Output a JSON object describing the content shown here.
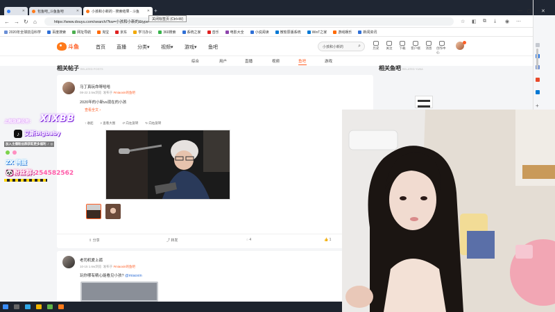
{
  "browser": {
    "tabs": [
      {
        "title": "",
        "active": false
      },
      {
        "title": "包鱼吧_斗鱼鱼吧",
        "active": false
      },
      {
        "title": "小孩和小新的 - 搜索结果 - 斗鱼",
        "active": true
      }
    ],
    "tooltip": "关闭标签页 (Ctrl+W)",
    "url": "https://www.douyu.com/search/?kw=小孩和小新的&type=",
    "bookmarks": [
      "2020年全球前沿科学",
      "百度搜索",
      "网址导航",
      "淘宝",
      "京东",
      "学习办公",
      "360搜索",
      "系统之家",
      "音乐",
      "电影大全",
      "小说阅读",
      "微软原版系统",
      "WinT之家",
      "游戏娱乐",
      "新闻资讯"
    ]
  },
  "site": {
    "brand": "斗鱼",
    "nav": [
      "首页",
      "直播",
      "分类▾",
      "视频▾",
      "游戏▾",
      "鱼吧"
    ],
    "search_placeholder": "小孩和小新的",
    "user_icons": [
      "历史",
      "关注",
      "下载",
      "客户端",
      "消息",
      "创作中心"
    ],
    "subtabs": [
      "综合",
      "用户",
      "直播",
      "视频",
      "鱼吧",
      "游戏"
    ],
    "active_subtab": "鱼吧",
    "section_left": "相关帖子",
    "section_left_sub": "RELATED POSTS",
    "section_right": "相关鱼吧",
    "section_right_sub": "RELATED YUBA"
  },
  "post1": {
    "author": "马丁真玩命呀哈哈",
    "meta_date": "08-22 2.5w浏览",
    "meta_from": "发布于",
    "meta_channel": "#miaoxin的鱼吧",
    "text": "2020年的小新vs现在的小孩",
    "more": "查看全文 ›",
    "tools": [
      "↑ 收起",
      "查看大图",
      "向左旋转",
      "向右旋转"
    ],
    "actions": {
      "share": "分享",
      "forward": "转发",
      "comments": "4",
      "likes": "1"
    }
  },
  "post2": {
    "author": "老司机爱上孤",
    "meta_date": "10-15 1.6w浏览",
    "meta_from": "发布于",
    "meta_channel": "#miaoxin的鱼吧",
    "text": "玩你哪有精心能看见小孩?",
    "mention": "@miaoxin"
  },
  "overlay": {
    "line1_label": "上舰急建设者：",
    "line1_name": "XIXBB",
    "tiktok_name": "艾斯bigbaby",
    "line3": "加入主播粉丝群获取更多福利 ♪ ◎",
    "line4": "ZX 鸭蛋",
    "line5_label": "粉丝群:",
    "line5_number": "254582562"
  },
  "colors": {
    "brand": "#ff5d23",
    "link": "#2f6fd6",
    "page_bg": "#f4f5f7",
    "taskbar": "#1d232d"
  }
}
